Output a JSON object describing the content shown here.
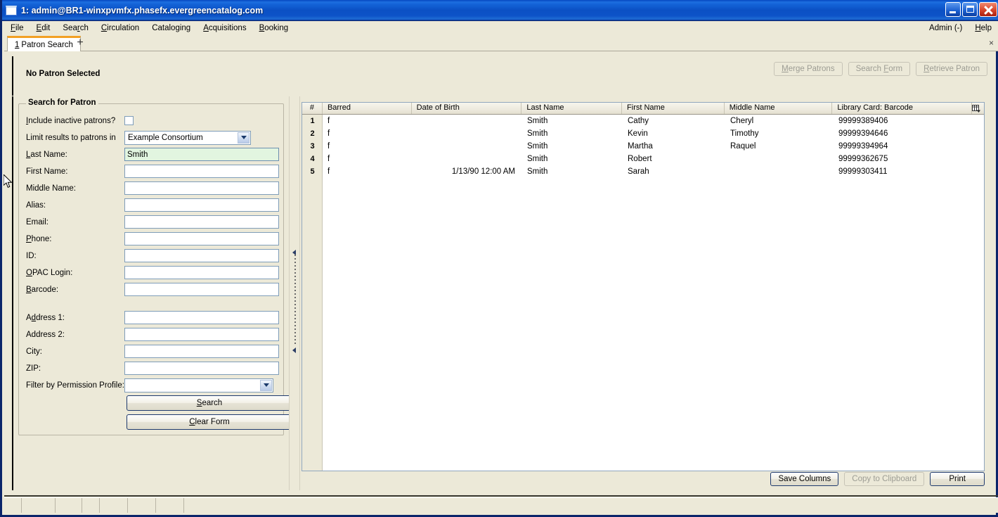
{
  "window": {
    "title": "1: admin@BR1-winxpvmfx.phasefx.evergreencatalog.com",
    "minimize_label": "Minimize",
    "maximize_label": "Maximize",
    "close_label": "Close"
  },
  "menubar": {
    "items": [
      {
        "label": "File",
        "accel": "F"
      },
      {
        "label": "Edit",
        "accel": "E"
      },
      {
        "label": "Search",
        "accel": "r"
      },
      {
        "label": "Circulation",
        "accel": "C"
      },
      {
        "label": "Cataloging",
        "accel": "g"
      },
      {
        "label": "Acquisitions",
        "accel": "A"
      },
      {
        "label": "Booking",
        "accel": "B"
      }
    ],
    "right": [
      {
        "label": "Admin (-)"
      },
      {
        "label": "Help"
      }
    ]
  },
  "tabs": {
    "active": {
      "number": "1",
      "label": "Patron Search"
    },
    "add_label": "+",
    "close_label": "×"
  },
  "patron_header": {
    "title": "No Patron Selected",
    "buttons": [
      {
        "label": "Merge Patrons",
        "disabled": true
      },
      {
        "label": "Search Form",
        "disabled": true
      },
      {
        "label": "Retrieve Patron",
        "disabled": true
      }
    ]
  },
  "search_form": {
    "legend": "Search for Patron",
    "fields": [
      {
        "label": "Include inactive patrons?",
        "type": "checkbox",
        "value": "",
        "checked": false
      },
      {
        "label": "Limit results to patrons in",
        "type": "select",
        "value": "Example Consortium"
      },
      {
        "label": "Last Name:",
        "type": "text",
        "value": "Smith",
        "focused": true
      },
      {
        "label": "First Name:",
        "type": "text",
        "value": ""
      },
      {
        "label": "Middle Name:",
        "type": "text",
        "value": ""
      },
      {
        "label": "Alias:",
        "type": "text",
        "value": ""
      },
      {
        "label": "Email:",
        "type": "text",
        "value": ""
      },
      {
        "label": "Phone:",
        "type": "text",
        "value": ""
      },
      {
        "label": "ID:",
        "type": "text",
        "value": ""
      },
      {
        "label": "OPAC Login:",
        "type": "text",
        "value": ""
      },
      {
        "label": "Barcode:",
        "type": "text",
        "value": ""
      },
      {
        "label": "Address 1:",
        "type": "text",
        "value": ""
      },
      {
        "label": "Address 2:",
        "type": "text",
        "value": ""
      },
      {
        "label": "City:",
        "type": "text",
        "value": ""
      },
      {
        "label": "ZIP:",
        "type": "text",
        "value": ""
      },
      {
        "label": "Filter by Permission Profile:",
        "type": "select",
        "value": ""
      }
    ],
    "buttons": [
      {
        "label": "Search"
      },
      {
        "label": "Clear Form"
      }
    ]
  },
  "results": {
    "columns": [
      "#",
      "Barred",
      "Date of Birth",
      "Last Name",
      "First Name",
      "Middle Name",
      "Library Card: Barcode"
    ],
    "column_picker_icon": "column-picker-icon",
    "rows": [
      {
        "num": "1",
        "barred": "f",
        "dob": "",
        "last": "Smith",
        "first": "Cathy",
        "middle": "Cheryl",
        "barcode": "99999389406"
      },
      {
        "num": "2",
        "barred": "f",
        "dob": "",
        "last": "Smith",
        "first": "Kevin",
        "middle": "Timothy",
        "barcode": "99999394646"
      },
      {
        "num": "3",
        "barred": "f",
        "dob": "",
        "last": "Smith",
        "first": "Martha",
        "middle": "Raquel",
        "barcode": "99999394964"
      },
      {
        "num": "4",
        "barred": "f",
        "dob": "",
        "last": "Smith",
        "first": "Robert",
        "middle": "",
        "barcode": "99999362675"
      },
      {
        "num": "5",
        "barred": "f",
        "dob": "1/13/90 12:00 AM",
        "last": "Smith",
        "first": "Sarah",
        "middle": "",
        "barcode": "99999303411"
      }
    ],
    "buttons": [
      {
        "label": "Save Columns",
        "disabled": false
      },
      {
        "label": "Copy to Clipboard",
        "disabled": true
      },
      {
        "label": "Print",
        "disabled": false
      }
    ]
  },
  "statusbar": {
    "cells": [
      "",
      "",
      "",
      "",
      "",
      "",
      "",
      ""
    ]
  },
  "colors": {
    "titlebar_blue": "#0b50c4",
    "frame_blue": "#0a246a",
    "chrome_beige": "#ece9d8",
    "tab_accent_orange": "#f2a024",
    "focused_field_green": "#e2f5e0",
    "field_border_blue": "#7f9db9"
  }
}
